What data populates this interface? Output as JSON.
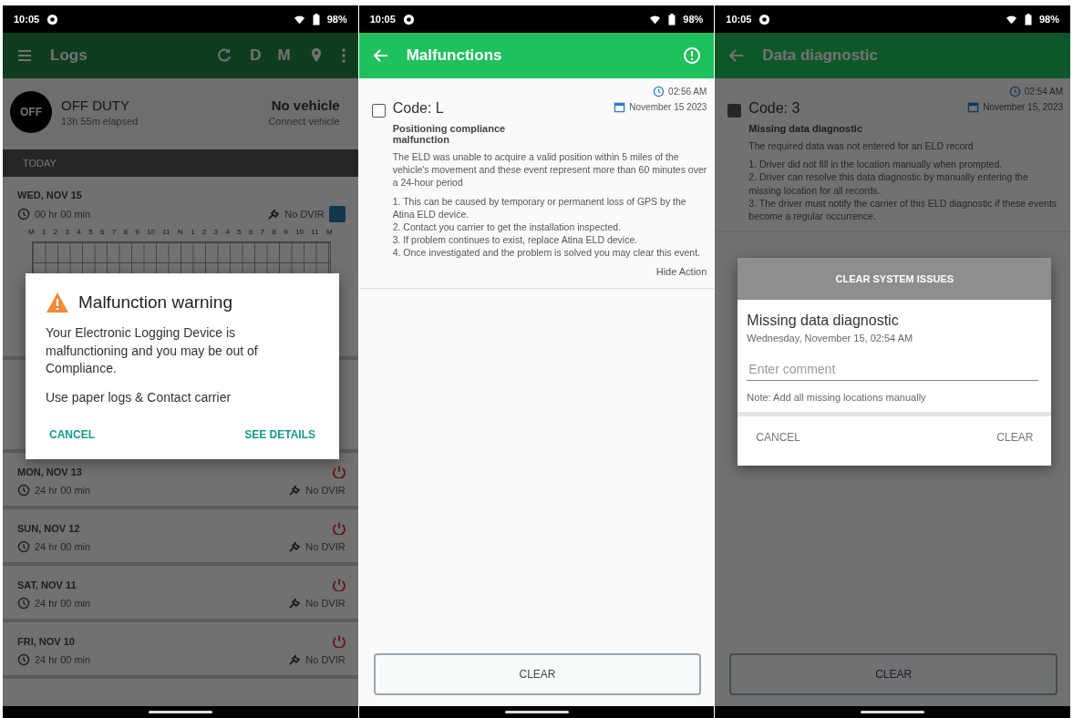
{
  "screens": [
    {
      "kind": "logs",
      "status_bar": {
        "time": "10:05",
        "battery": "98%"
      },
      "app_bar": {
        "title": "Logs",
        "letters": [
          "D",
          "M"
        ]
      },
      "duty": {
        "badge": "OFF",
        "status": "OFF DUTY",
        "subtitle": "13h 55m elapsed",
        "vehicle": "No vehicle",
        "vehicle_action": "Connect vehicle"
      },
      "section": "TODAY",
      "today": {
        "date": "WED, NOV 15",
        "duration": "00 hr 00 min",
        "dvir": "No DVIR"
      },
      "hours": [
        "M",
        "1",
        "2",
        "3",
        "4",
        "5",
        "6",
        "7",
        "8",
        "9",
        "10",
        "11",
        "N",
        "1",
        "2",
        "3",
        "4",
        "5",
        "6",
        "7",
        "8",
        "9",
        "10",
        "11",
        "M"
      ],
      "days": [
        {
          "date": "MON, NOV 13",
          "duration": "24 hr 00 min",
          "dvir": "No DVIR"
        },
        {
          "date": "SUN, NOV 12",
          "duration": "24 hr 00 min",
          "dvir": "No DVIR"
        },
        {
          "date": "SAT, NOV 11",
          "duration": "24 hr 00 min",
          "dvir": "No DVIR"
        },
        {
          "date": "FRI, NOV 10",
          "duration": "24 hr 00 min",
          "dvir": "No DVIR"
        }
      ],
      "dialog": {
        "title": "Malfunction warning",
        "body": "Your Electronic Logging Device is malfunctioning and you may be out of Compliance.",
        "note": "Use paper logs & Contact carrier",
        "cancel": "CANCEL",
        "confirm": "SEE DETAILS"
      }
    },
    {
      "kind": "detail",
      "status_bar": {
        "time": "10:05",
        "battery": "98%"
      },
      "app_bar": {
        "title": "Malfunctions",
        "info": true
      },
      "event": {
        "checked": false,
        "code": "Code: L",
        "name": "Positioning compliance malfunction",
        "time": "02:56 AM",
        "date": "November 15 2023",
        "description": "The ELD was unable to acquire a valid position within 5 miles of the vehicle's movement and these event represent more than 60 minutes over a 24-hour period",
        "steps": [
          "1.  This can be caused by temporary or permanent loss of GPS by the Atina ELD device.",
          "2. Contact you carrier to get the installation inspected.",
          "3. If problem continues to exist, replace Atina ELD device.",
          "4. Once investigated and the problem is solved you may clear this event."
        ],
        "action": "Hide Action"
      },
      "button": "CLEAR"
    },
    {
      "kind": "detail",
      "status_bar": {
        "time": "10:05",
        "battery": "98%"
      },
      "app_bar": {
        "title": "Data diagnostic",
        "info": false
      },
      "event": {
        "checked": true,
        "code": "Code: 3",
        "name": "Missing data diagnostic",
        "time": "02:54 AM",
        "date": "November 15, 2023",
        "description": "The required data was not entered for an ELD record",
        "steps": [
          "1. Driver did not fill in the location manually when prompted.",
          "2. Driver can resolve this data diagnostic by manually entering the missing location for all records.",
          "3. The driver must notify the carrier of this ELD diagnostic if these events become a regular occurrence."
        ]
      },
      "button": "CLEAR",
      "dialog": {
        "header": "CLEAR SYSTEM ISSUES",
        "title": "Missing data diagnostic",
        "subtitle": "Wednesday, November 15, 02:54 AM",
        "placeholder": "Enter comment",
        "note": "Note: Add all missing locations manually",
        "cancel": "CANCEL",
        "confirm": "CLEAR"
      }
    }
  ]
}
